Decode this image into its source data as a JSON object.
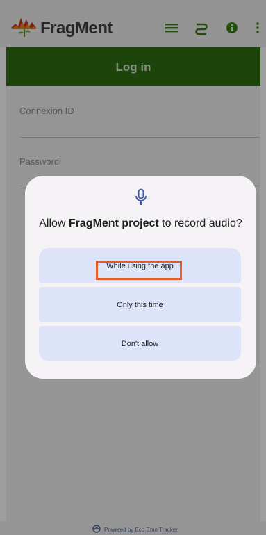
{
  "app": {
    "name": "FragMent",
    "icons": [
      "menu-icon",
      "route-icon",
      "info-icon",
      "more-vert-icon"
    ]
  },
  "header": {
    "title": "Log in"
  },
  "form": {
    "connexion_label": "Connexion ID",
    "password_label": "Password"
  },
  "footer": {
    "text": "Powered by Eco Emo Tracker"
  },
  "dialog": {
    "icon": "microphone-icon",
    "title_prefix": "Allow ",
    "title_app": "FragMent project",
    "title_suffix": " to record audio?",
    "options": [
      "While using the app",
      "Only this time",
      "Don't allow"
    ],
    "highlighted_option": "While using the app"
  },
  "colors": {
    "header_green": "#2f6e12",
    "dialog_bg": "#f6f3f7",
    "option_bg": "#dde4fa",
    "highlight": "#ea5b24",
    "toolbar_icon_green": "#3a7f17"
  }
}
